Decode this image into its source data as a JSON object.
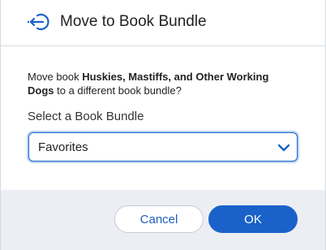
{
  "dialog": {
    "title": "Move to Book Bundle",
    "icon": "move-arrow-icon"
  },
  "message": {
    "prefix": "Move book ",
    "book_title": "Huskies, Mastiffs, and Other Working Dogs",
    "suffix": " to a different book bundle?"
  },
  "bundle_select": {
    "label": "Select a Book Bundle",
    "selected_value": "Favorites",
    "icon": "chevron-down-icon"
  },
  "buttons": {
    "cancel_label": "Cancel",
    "ok_label": "OK"
  },
  "colors": {
    "accent": "#1a62c9",
    "footer_bg": "#eceef3",
    "focus_ring": "#b9d3f5"
  }
}
